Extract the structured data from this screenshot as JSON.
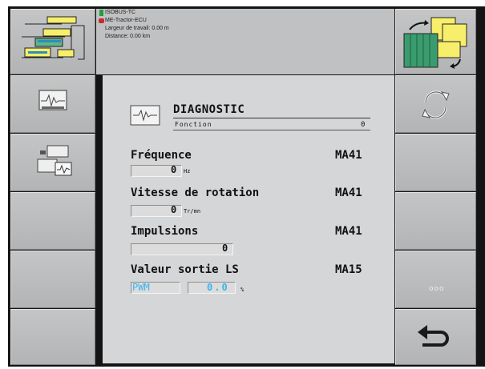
{
  "status": {
    "isobus": "ISOBUS-TC",
    "ecu": "ME-Tractor-ECU",
    "working_width": "Largeur de travail: 0.00 m",
    "distance": "Distance: 0.00 km"
  },
  "header": {
    "title": "DIAGNOSTIC",
    "function_label": "Fonction",
    "function_value": "0"
  },
  "rows": {
    "frequence": {
      "label": "Fréquence",
      "code": "MA41",
      "value": "0",
      "unit": "Hz"
    },
    "vitesse": {
      "label": "Vitesse de rotation",
      "code": "MA41",
      "value": "0",
      "unit": "Tr/mn"
    },
    "impulsions": {
      "label": "Impulsions",
      "code": "MA41",
      "value": "0"
    },
    "valeur": {
      "label": "Valeur sortie LS",
      "code": "MA15",
      "mode": "PWM",
      "value": "0.0",
      "unit": "%"
    }
  },
  "softkeys": {
    "more_label": "ooo"
  },
  "colors": {
    "background": "#c4c5c6",
    "panel": "#d5d6d7",
    "accent": "#39b6ee",
    "frame": "#141414"
  },
  "icons": [
    "isobus-icon",
    "tractor-icon",
    "machine-overview-icon",
    "nav-forward-icon",
    "diagnostic-icon",
    "machine-diagnostic-icon",
    "refresh-icon",
    "more-icon",
    "back-icon"
  ]
}
